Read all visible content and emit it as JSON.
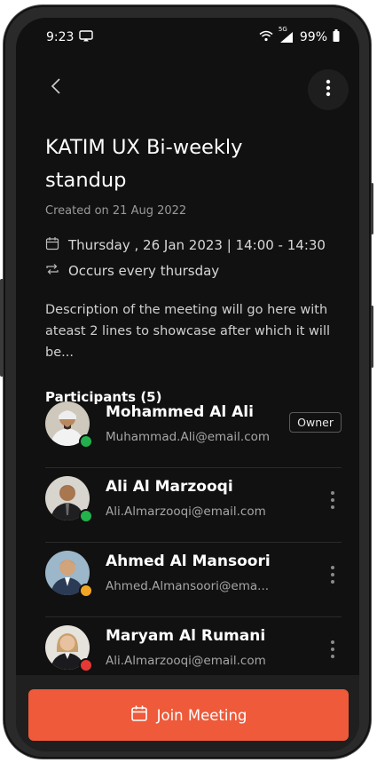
{
  "status_bar": {
    "time": "9:23",
    "signal_label": "5G",
    "battery": "99%"
  },
  "meeting": {
    "title": "KATIM UX Bi-weekly standup",
    "created": "Created on 21 Aug 2022",
    "schedule": "Thursday , 26 Jan 2023 | 14:00 - 14:30",
    "recurrence": "Occurs every thursday",
    "description": "Description of the meeting will go here with ateast 2 lines to showcase after which it will be..."
  },
  "participants_section": {
    "title": "Participants (5)"
  },
  "participants": [
    {
      "name": "Mohammed Al Ali",
      "email": "Muhammad.Ali@email.com",
      "badge": "Owner",
      "status_color": "#22b14c"
    },
    {
      "name": "Ali Al Marzooqi",
      "email": "Ali.Almarzooqi@email.com",
      "badge": "",
      "status_color": "#22b14c"
    },
    {
      "name": "Ahmed Al Mansoori",
      "email": "Ahmed.Almansoori@ema...",
      "badge": "",
      "status_color": "#f2a623"
    },
    {
      "name": "Maryam Al Rumani",
      "email": "Ali.Almarzooqi@email.com",
      "badge": "",
      "status_color": "#e53935"
    }
  ],
  "actions": {
    "join_label": "Join Meeting"
  },
  "colors": {
    "accent": "#ee5a3a",
    "background": "#111111"
  }
}
